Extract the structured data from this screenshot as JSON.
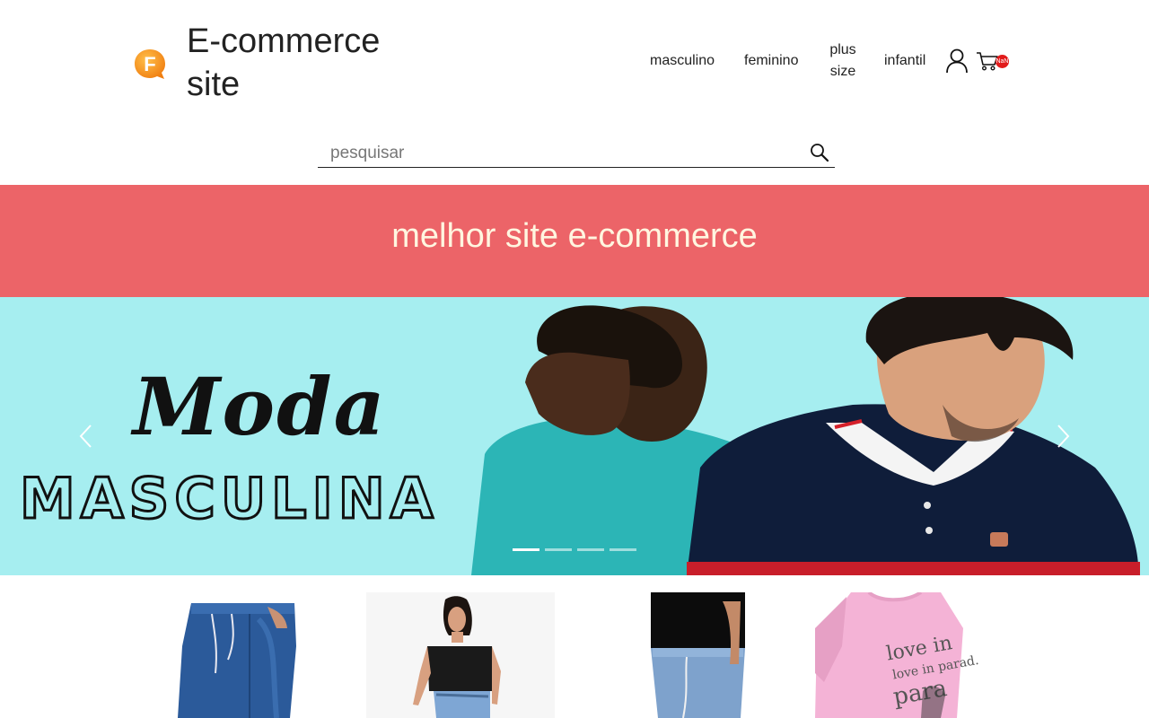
{
  "header": {
    "logo_letter": "F",
    "brand_name": "E-commerce site",
    "nav": [
      {
        "label": "masculino"
      },
      {
        "label": "feminino"
      },
      {
        "label": "plus size"
      },
      {
        "label": "infantil"
      }
    ],
    "cart_count": "NaN"
  },
  "search": {
    "placeholder": "pesquisar"
  },
  "promo": {
    "text": "melhor site e-commerce"
  },
  "carousel": {
    "slide_title": "Moda",
    "slide_subtitle": "MASCULINA",
    "active_index": 0,
    "slide_count": 4,
    "background": "#a6eef0"
  },
  "colors": {
    "promo_bg": "#ec6468",
    "promo_text": "#fff6e0",
    "badge": "#e21b1b",
    "logo": "#f7941d"
  },
  "icons": [
    "user-icon",
    "cart-icon",
    "search-icon",
    "chevron-left-icon",
    "chevron-right-icon"
  ]
}
